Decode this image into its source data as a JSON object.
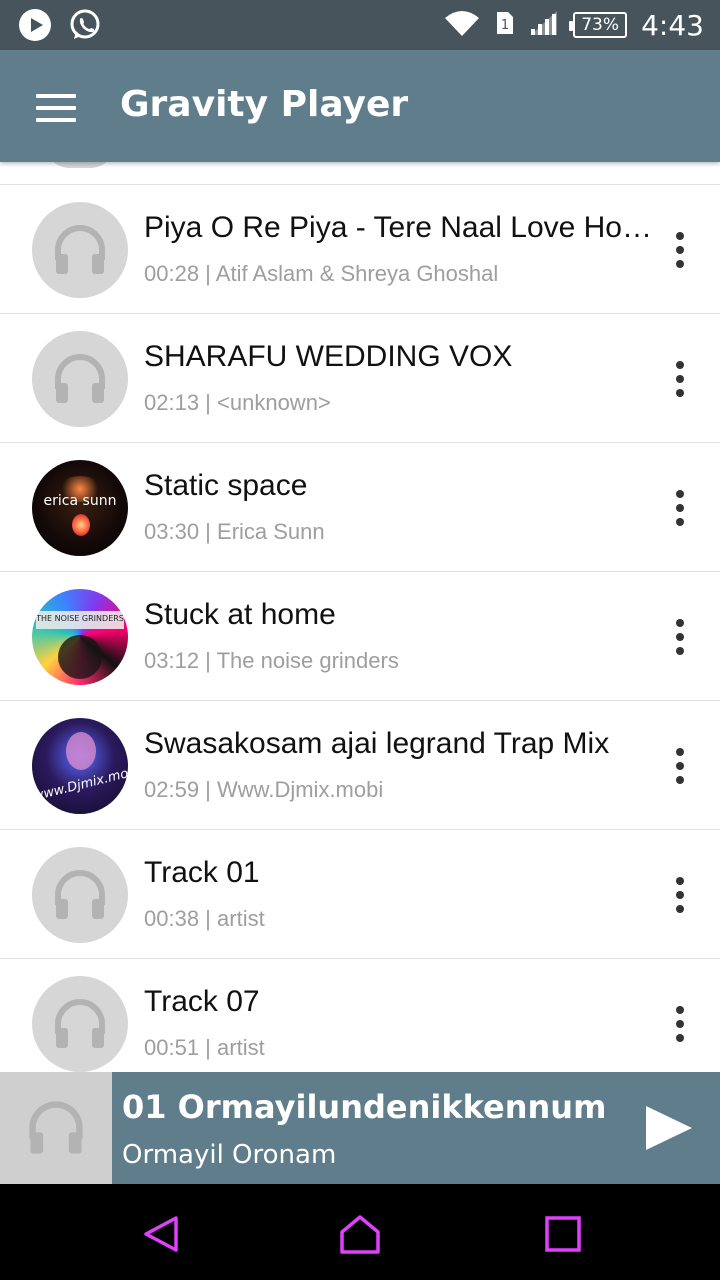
{
  "status_bar": {
    "time": "4:43",
    "battery": "73%",
    "sim_slot": "1",
    "icons": [
      "play-circle-icon",
      "whatsapp-icon",
      "wifi-icon",
      "sim-icon",
      "signal-icon",
      "battery-icon"
    ]
  },
  "app_bar": {
    "title": "Gravity Player",
    "menu_icon": "hamburger-menu-icon"
  },
  "songs": [
    {
      "title": "Piya O Re Piya - Tere Naal Love Ho Gaya",
      "duration": "00:28",
      "artist": "Atif Aslam & Shreya Ghoshal",
      "art": "headphones-placeholder"
    },
    {
      "title": "SHARAFU WEDDING VOX",
      "duration": "02:13",
      "artist": "<unknown>",
      "art": "headphones-placeholder"
    },
    {
      "title": "Static space",
      "duration": "03:30",
      "artist": "Erica Sunn",
      "art": "album-art",
      "art_text": "erica sunn"
    },
    {
      "title": "Stuck at home",
      "duration": "03:12",
      "artist": "The noise grinders",
      "art": "album-art",
      "art_text": "THE NOISE GRINDERS"
    },
    {
      "title": "Swasakosam ajai legrand Trap Mix",
      "duration": "02:59",
      "artist": "Www.Djmix.mobi",
      "art": "album-art",
      "art_text": "www.Djmix.mobi"
    },
    {
      "title": "Track 01",
      "duration": "00:38",
      "artist": "artist",
      "art": "headphones-placeholder"
    },
    {
      "title": "Track 07",
      "duration": "00:51",
      "artist": "artist",
      "art": "headphones-placeholder"
    }
  ],
  "mini_player": {
    "title": "01 Ormayilundenikkennum",
    "artist": "Ormayil Oronam",
    "play_icon": "play-icon"
  },
  "nav_bar": {
    "icons": [
      "back-icon",
      "home-icon",
      "recents-icon"
    ],
    "color": "#e040fb"
  },
  "colors": {
    "primary": "#607d8b",
    "status_bar": "#48545c",
    "placeholder": "#d6d6d6"
  }
}
